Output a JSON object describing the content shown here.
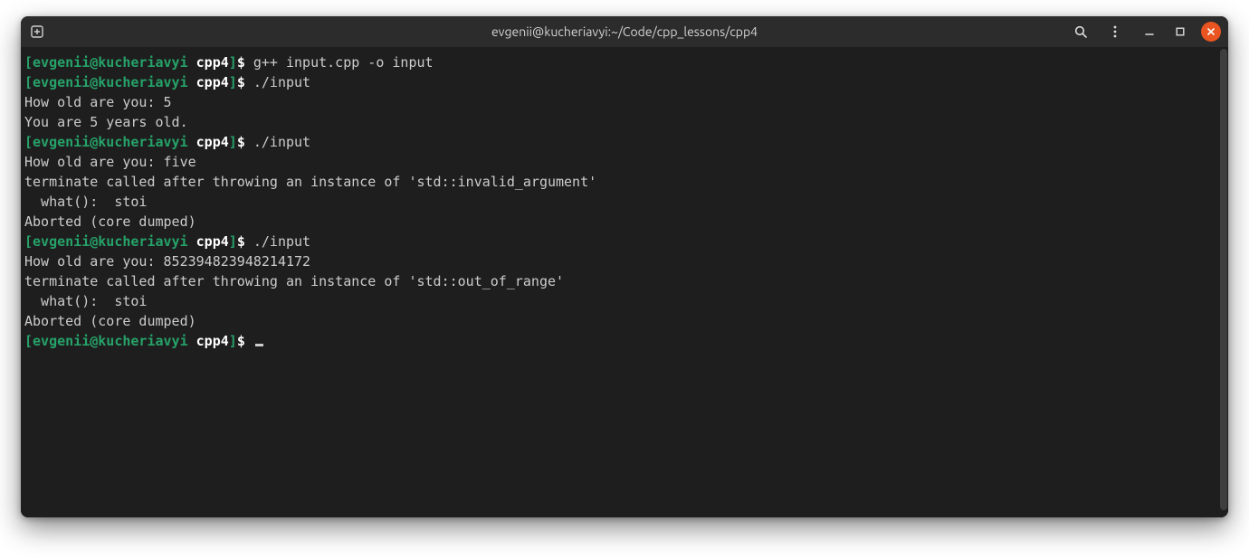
{
  "window": {
    "title": "evgenii@kucheriavyi:~/Code/cpp_lessons/cpp4"
  },
  "prompt": {
    "open": "[",
    "user_host": "evgenii@kucheriavyi",
    "sep": " ",
    "cwd": "cpp4",
    "close": "]",
    "symbol": "$"
  },
  "lines": {
    "cmd1": "g++ input.cpp -o input",
    "cmd2": "./input",
    "out2a": "How old are you: 5",
    "out2b": "You are 5 years old.",
    "cmd3": "./input",
    "out3a": "How old are you: five",
    "out3b": "terminate called after throwing an instance of 'std::invalid_argument'",
    "out3c": "  what():  stoi",
    "out3d": "Aborted (core dumped)",
    "cmd4": "./input",
    "out4a": "How old are you: 852394823948214172",
    "out4b": "terminate called after throwing an instance of 'std::out_of_range'",
    "out4c": "  what():  stoi",
    "out4d": "Aborted (core dumped)"
  }
}
